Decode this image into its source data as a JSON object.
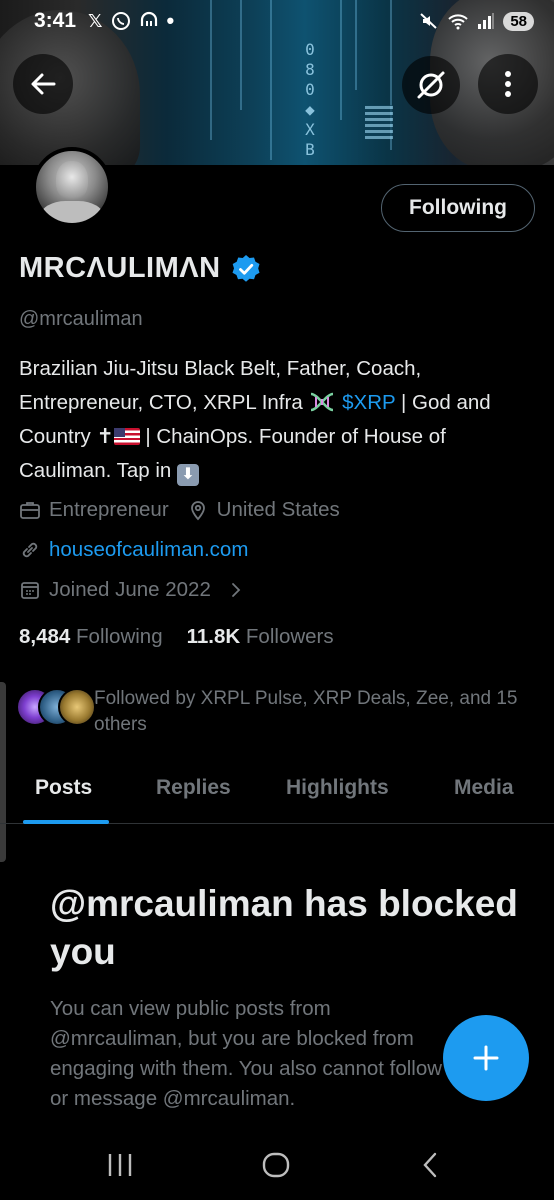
{
  "status_bar": {
    "time": "3:41",
    "notification_icons": [
      "x-icon",
      "whatsapp-icon",
      "threads-icon",
      "dot-icon"
    ],
    "right_icons": [
      "mute-icon",
      "wifi-icon",
      "signal-icon"
    ],
    "battery": "58"
  },
  "header": {
    "back_icon": "arrow-left-icon",
    "grok_icon": "grok-icon",
    "more_icon": "more-vertical-icon",
    "banner_glyphs": "0\n8\n0\n◆\nX\nB"
  },
  "profile": {
    "display_name": "MRCΛULIMΛN",
    "handle": "@mrcauliman",
    "following_button": "Following",
    "bio": {
      "part1": "Brazilian Jiu-Jitsu Black Belt, Father, Coach, Entrepreneur, CTO, XRPL Infra ",
      "cashtag": "$XRP",
      "part2": " | God and Country ✝",
      "part3": " | ChainOps. Founder of House of Cauliman. Tap in ",
      "down_arrow": "⬇"
    },
    "category": "Entrepreneur",
    "location": "United States",
    "website": "houseofcauliman.com",
    "joined": "Joined June 2022",
    "following_count": "8,484",
    "following_label": "Following",
    "followers_count": "11.8K",
    "followers_label": "Followers",
    "followed_by": "Followed by XRPL Pulse, XRP Deals, Zee, and 15 others"
  },
  "tabs": [
    {
      "label": "Posts",
      "active": true
    },
    {
      "label": "Replies",
      "active": false
    },
    {
      "label": "Highlights",
      "active": false
    },
    {
      "label": "Media",
      "active": false
    }
  ],
  "blocked": {
    "title": "@mrcauliman has blocked you",
    "body": "You can view public posts from @mrcauliman, but you are blocked from engaging with them. You also cannot follow or message @mrcauliman."
  },
  "fab": {
    "icon": "plus-icon"
  },
  "system_nav": [
    "recents-icon",
    "home-icon",
    "back-icon"
  ],
  "colors": {
    "accent": "#1d9bf0",
    "secondary_text": "#71767b",
    "primary_text": "#e7e9ea",
    "background": "#000000"
  }
}
